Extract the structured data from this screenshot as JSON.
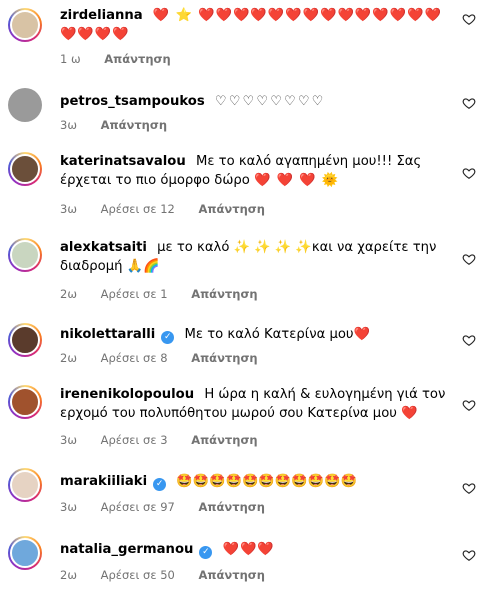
{
  "comments": [
    {
      "username": "zirdelianna",
      "text": "",
      "emoji": "❤️ ⭐ ❤️❤️❤️❤️❤️❤️❤️❤️❤️❤️❤️❤️❤️❤️❤️❤️❤️❤️",
      "time": "1 ω",
      "likes": "",
      "reply": "Απάντηση",
      "verified": false,
      "avatar_color": "#d8c3a5"
    },
    {
      "username": "petros_tsampoukos",
      "text": "",
      "emoji": "♡♡♡♡♡♡♡♡",
      "time": "3ω",
      "likes": "",
      "reply": "Απάντηση",
      "verified": false,
      "avatar_color": "#9a9a9a"
    },
    {
      "username": "katerinatsavalou",
      "text": "Με το καλό αγαπημένη μου!!! Σας έρχεται το πιο όμορφο δώρο",
      "emoji": "❤️ ❤️ ❤️ 🌞",
      "time": "3ω",
      "likes": "Αρέσει σε 12",
      "reply": "Απάντηση",
      "verified": false,
      "avatar_color": "#6b4f3a"
    },
    {
      "username": "alexkatsaiti",
      "text": "με το καλό ✨ ✨ ✨ ✨και να χαρείτε την διαδρομή",
      "emoji": "🙏🌈",
      "time": "2ω",
      "likes": "Αρέσει σε 1",
      "reply": "Απάντηση",
      "verified": false,
      "avatar_color": "#c9d6c0"
    },
    {
      "username": "nikolettaralli",
      "text": "Με το καλό Κατερίνα μου",
      "emoji": "❤️",
      "time": "2ω",
      "likes": "Αρέσει σε 8",
      "reply": "Απάντηση",
      "verified": true,
      "avatar_color": "#5a3b2c"
    },
    {
      "username": "irenenikolopoulou",
      "text": "Η ώρα η καλή & ευλογημένη γιά τον ερχομό του πολυπόθητου μωρού σου Κατερίνα μου",
      "emoji": "❤️",
      "time": "3ω",
      "likes": "Αρέσει σε 3",
      "reply": "Απάντηση",
      "verified": false,
      "avatar_color": "#a0522d"
    },
    {
      "username": "marakiiliaki",
      "text": "",
      "emoji": "🤩🤩🤩🤩🤩🤩🤩🤩🤩🤩🤩",
      "time": "3ω",
      "likes": "Αρέσει σε 97",
      "reply": "Απάντηση",
      "verified": true,
      "avatar_color": "#e6d3c3"
    },
    {
      "username": "natalia_germanou",
      "text": "",
      "emoji": "❤️❤️❤️",
      "time": "2ω",
      "likes": "Αρέσει σε 50",
      "reply": "Απάντηση",
      "verified": true,
      "avatar_color": "#6fa8dc"
    }
  ]
}
